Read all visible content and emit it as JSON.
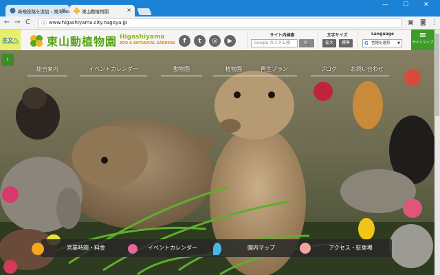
{
  "browser": {
    "tabs": [
      {
        "title": "新規投稿を追加 ‹ 東海Wo",
        "close": "×"
      },
      {
        "title": "東山動植物園",
        "close": "×"
      }
    ],
    "url": "www.higashiyama.city.nagoya.jp",
    "window_controls": {
      "minimize": "—",
      "maximize": "☐",
      "close": "✕"
    },
    "nav": {
      "back": "←",
      "forward": "→",
      "reload": "C"
    }
  },
  "site": {
    "skip_link": "本文へ",
    "logo_jp": "東山動植物園",
    "logo_en": "Higashiyama",
    "logo_sub": "ZOO & BOTANICAL GARDENS",
    "social": [
      "f",
      "t",
      "◎",
      "▶"
    ],
    "search": {
      "title": "サイト内検索",
      "placeholder": "Google カスタム検",
      "button": "🔍"
    },
    "font_size": {
      "title": "文字サイズ",
      "large": "拡大",
      "normal": "標準"
    },
    "language": {
      "title": "Language",
      "select": "言語を選択",
      "arrow": "▼",
      "g": "G"
    },
    "sitemap": {
      "label": "サイトマップ",
      "icon": "≡"
    },
    "side_arrow": "›",
    "global_nav": [
      "総合案内",
      "イベントカレンダー",
      "動物園",
      "植物園",
      "再生プラン",
      "ブログ",
      "お問い合わせ"
    ],
    "bottom_nav": [
      "営業時間・料金",
      "イベントカレンダー",
      "園内マップ",
      "アクセス・駐車場"
    ]
  },
  "colors": {
    "chrome": "#1b82d6",
    "green": "#3d9b29",
    "skip_bg": "#e6f068"
  }
}
